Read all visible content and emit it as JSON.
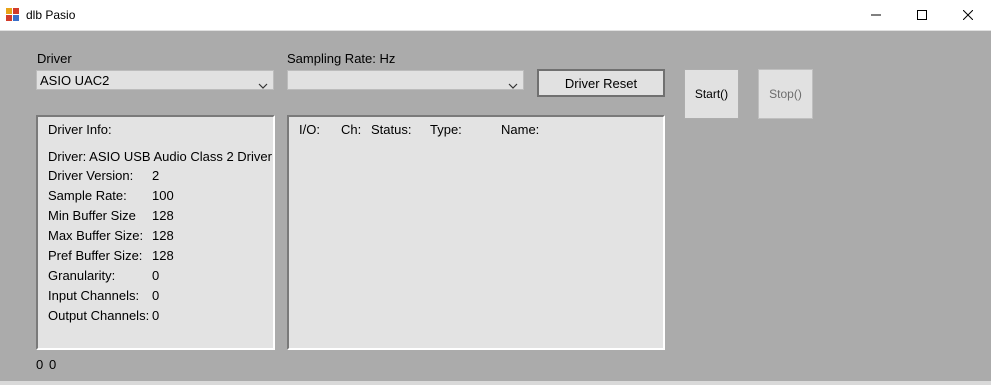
{
  "window": {
    "title": "dlb Pasio"
  },
  "driver": {
    "label": "Driver",
    "selected": "ASIO UAC2"
  },
  "sampling": {
    "label": "Sampling Rate: Hz",
    "selected": ""
  },
  "buttons": {
    "driver_reset": "Driver Reset",
    "start": "Start()",
    "stop": "Stop()"
  },
  "info": {
    "heading": "Driver Info:",
    "driver_line": "Driver: ASIO USB Audio Class 2 Driver",
    "rows": [
      {
        "label": "Driver Version:",
        "value": "2"
      },
      {
        "label": "Sample Rate:",
        "value": "100"
      },
      {
        "label": "Min Buffer Size",
        "value": "128"
      },
      {
        "label": "Max Buffer Size:",
        "value": "128"
      },
      {
        "label": "Pref Buffer Size:",
        "value": "128"
      },
      {
        "label": "Granularity:",
        "value": "0"
      },
      {
        "label": "Input Channels:",
        "value": "0"
      },
      {
        "label": "Output Channels:",
        "value": "0"
      }
    ]
  },
  "channels": {
    "headers": [
      "I/O:",
      "Ch:",
      "Status:",
      "Type:",
      "Name:"
    ]
  },
  "status_bar": {
    "left": "0",
    "right": "0"
  },
  "colors": {
    "background": "#ababab",
    "panel": "#e3e3e3",
    "button": "#e1e1e1"
  },
  "icons": [
    "app-icon",
    "minimize-icon",
    "maximize-icon",
    "close-icon",
    "chevron-down-icon"
  ]
}
